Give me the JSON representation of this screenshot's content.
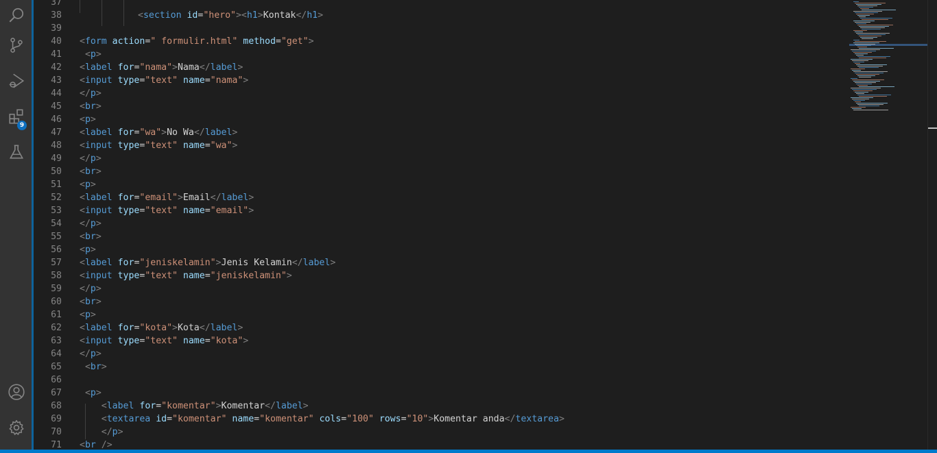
{
  "activity_bar": {
    "items": [
      {
        "name": "explorer-search",
        "icon": "search-icon"
      },
      {
        "name": "source-control",
        "icon": "source-control-icon"
      },
      {
        "name": "run-debug",
        "icon": "run-debug-icon"
      },
      {
        "name": "extensions",
        "icon": "extensions-icon",
        "badge": "9"
      },
      {
        "name": "testing",
        "icon": "flask-icon"
      }
    ],
    "bottom": [
      {
        "name": "accounts",
        "icon": "account-icon"
      },
      {
        "name": "manage",
        "icon": "gear-icon"
      }
    ],
    "accent": "#0e639c",
    "badge_color": "#0e70c0"
  },
  "editor": {
    "colors": {
      "background": "#1e1e1e",
      "tag": "#569cd6",
      "attribute": "#9cdcfe",
      "string": "#ce9178",
      "text": "#d4d4d4",
      "line_number": "#858585"
    },
    "lines": [
      {
        "n": "37",
        "tokens": []
      },
      {
        "n": "38",
        "tokens": [
          {
            "t": "<",
            "c": "punc"
          },
          {
            "t": "section",
            "c": "tag"
          },
          {
            "t": " ",
            "c": "txt"
          },
          {
            "t": "id",
            "c": "attr"
          },
          {
            "t": "=",
            "c": "txt"
          },
          {
            "t": "\"hero\"",
            "c": "str"
          },
          {
            "t": "><",
            "c": "punc"
          },
          {
            "t": "h1",
            "c": "tag"
          },
          {
            "t": ">",
            "c": "punc"
          },
          {
            "t": "Kontak",
            "c": "txt"
          },
          {
            "t": "</",
            "c": "punc"
          },
          {
            "t": "h1",
            "c": "tag"
          },
          {
            "t": ">",
            "c": "punc"
          }
        ]
      },
      {
        "n": "39",
        "tokens": []
      },
      {
        "n": "40",
        "tokens": [
          {
            "t": "<",
            "c": "punc"
          },
          {
            "t": "form",
            "c": "tag"
          },
          {
            "t": " ",
            "c": "txt"
          },
          {
            "t": "action",
            "c": "attr"
          },
          {
            "t": "=",
            "c": "txt"
          },
          {
            "t": "\" formulir.html\"",
            "c": "str"
          },
          {
            "t": " ",
            "c": "txt"
          },
          {
            "t": "method",
            "c": "attr"
          },
          {
            "t": "=",
            "c": "txt"
          },
          {
            "t": "\"get\"",
            "c": "str"
          },
          {
            "t": ">",
            "c": "punc"
          }
        ]
      },
      {
        "n": "41",
        "tokens": [
          {
            "t": " ",
            "c": "txt"
          },
          {
            "t": "<",
            "c": "punc"
          },
          {
            "t": "p",
            "c": "tag"
          },
          {
            "t": ">",
            "c": "punc"
          }
        ]
      },
      {
        "n": "42",
        "tokens": [
          {
            "t": "<",
            "c": "punc"
          },
          {
            "t": "label",
            "c": "tag"
          },
          {
            "t": " ",
            "c": "txt"
          },
          {
            "t": "for",
            "c": "attr"
          },
          {
            "t": "=",
            "c": "txt"
          },
          {
            "t": "\"nama\"",
            "c": "str"
          },
          {
            "t": ">",
            "c": "punc"
          },
          {
            "t": "Nama",
            "c": "txt"
          },
          {
            "t": "</",
            "c": "punc"
          },
          {
            "t": "label",
            "c": "tag"
          },
          {
            "t": ">",
            "c": "punc"
          }
        ]
      },
      {
        "n": "43",
        "tokens": [
          {
            "t": "<",
            "c": "punc"
          },
          {
            "t": "input",
            "c": "tag"
          },
          {
            "t": " ",
            "c": "txt"
          },
          {
            "t": "type",
            "c": "attr"
          },
          {
            "t": "=",
            "c": "txt"
          },
          {
            "t": "\"text\"",
            "c": "str"
          },
          {
            "t": " ",
            "c": "txt"
          },
          {
            "t": "name",
            "c": "attr"
          },
          {
            "t": "=",
            "c": "txt"
          },
          {
            "t": "\"nama\"",
            "c": "str"
          },
          {
            "t": ">",
            "c": "punc"
          }
        ]
      },
      {
        "n": "44",
        "tokens": [
          {
            "t": "</",
            "c": "punc"
          },
          {
            "t": "p",
            "c": "tag"
          },
          {
            "t": ">",
            "c": "punc"
          }
        ]
      },
      {
        "n": "45",
        "tokens": [
          {
            "t": "<",
            "c": "punc"
          },
          {
            "t": "br",
            "c": "tag"
          },
          {
            "t": ">",
            "c": "punc"
          }
        ]
      },
      {
        "n": "46",
        "tokens": [
          {
            "t": "<",
            "c": "punc"
          },
          {
            "t": "p",
            "c": "tag"
          },
          {
            "t": ">",
            "c": "punc"
          }
        ]
      },
      {
        "n": "47",
        "tokens": [
          {
            "t": "<",
            "c": "punc"
          },
          {
            "t": "label",
            "c": "tag"
          },
          {
            "t": " ",
            "c": "txt"
          },
          {
            "t": "for",
            "c": "attr"
          },
          {
            "t": "=",
            "c": "txt"
          },
          {
            "t": "\"wa\"",
            "c": "str"
          },
          {
            "t": ">",
            "c": "punc"
          },
          {
            "t": "No Wa",
            "c": "txt"
          },
          {
            "t": "</",
            "c": "punc"
          },
          {
            "t": "label",
            "c": "tag"
          },
          {
            "t": ">",
            "c": "punc"
          }
        ]
      },
      {
        "n": "48",
        "tokens": [
          {
            "t": "<",
            "c": "punc"
          },
          {
            "t": "input",
            "c": "tag"
          },
          {
            "t": " ",
            "c": "txt"
          },
          {
            "t": "type",
            "c": "attr"
          },
          {
            "t": "=",
            "c": "txt"
          },
          {
            "t": "\"text\"",
            "c": "str"
          },
          {
            "t": " ",
            "c": "txt"
          },
          {
            "t": "name",
            "c": "attr"
          },
          {
            "t": "=",
            "c": "txt"
          },
          {
            "t": "\"wa\"",
            "c": "str"
          },
          {
            "t": ">",
            "c": "punc"
          }
        ]
      },
      {
        "n": "49",
        "tokens": [
          {
            "t": "</",
            "c": "punc"
          },
          {
            "t": "p",
            "c": "tag"
          },
          {
            "t": ">",
            "c": "punc"
          }
        ]
      },
      {
        "n": "50",
        "tokens": [
          {
            "t": "<",
            "c": "punc"
          },
          {
            "t": "br",
            "c": "tag"
          },
          {
            "t": ">",
            "c": "punc"
          }
        ]
      },
      {
        "n": "51",
        "tokens": [
          {
            "t": "<",
            "c": "punc"
          },
          {
            "t": "p",
            "c": "tag"
          },
          {
            "t": ">",
            "c": "punc"
          }
        ]
      },
      {
        "n": "52",
        "tokens": [
          {
            "t": "<",
            "c": "punc"
          },
          {
            "t": "label",
            "c": "tag"
          },
          {
            "t": " ",
            "c": "txt"
          },
          {
            "t": "for",
            "c": "attr"
          },
          {
            "t": "=",
            "c": "txt"
          },
          {
            "t": "\"email\"",
            "c": "str"
          },
          {
            "t": ">",
            "c": "punc"
          },
          {
            "t": "Email",
            "c": "txt"
          },
          {
            "t": "</",
            "c": "punc"
          },
          {
            "t": "label",
            "c": "tag"
          },
          {
            "t": ">",
            "c": "punc"
          }
        ]
      },
      {
        "n": "53",
        "tokens": [
          {
            "t": "<",
            "c": "punc"
          },
          {
            "t": "input",
            "c": "tag"
          },
          {
            "t": " ",
            "c": "txt"
          },
          {
            "t": "type",
            "c": "attr"
          },
          {
            "t": "=",
            "c": "txt"
          },
          {
            "t": "\"text\"",
            "c": "str"
          },
          {
            "t": " ",
            "c": "txt"
          },
          {
            "t": "name",
            "c": "attr"
          },
          {
            "t": "=",
            "c": "txt"
          },
          {
            "t": "\"email\"",
            "c": "str"
          },
          {
            "t": ">",
            "c": "punc"
          }
        ]
      },
      {
        "n": "54",
        "tokens": [
          {
            "t": "</",
            "c": "punc"
          },
          {
            "t": "p",
            "c": "tag"
          },
          {
            "t": ">",
            "c": "punc"
          }
        ]
      },
      {
        "n": "55",
        "tokens": [
          {
            "t": "<",
            "c": "punc"
          },
          {
            "t": "br",
            "c": "tag"
          },
          {
            "t": ">",
            "c": "punc"
          }
        ]
      },
      {
        "n": "56",
        "tokens": [
          {
            "t": "<",
            "c": "punc"
          },
          {
            "t": "p",
            "c": "tag"
          },
          {
            "t": ">",
            "c": "punc"
          }
        ]
      },
      {
        "n": "57",
        "tokens": [
          {
            "t": "<",
            "c": "punc"
          },
          {
            "t": "label",
            "c": "tag"
          },
          {
            "t": " ",
            "c": "txt"
          },
          {
            "t": "for",
            "c": "attr"
          },
          {
            "t": "=",
            "c": "txt"
          },
          {
            "t": "\"jeniskelamin\"",
            "c": "str"
          },
          {
            "t": ">",
            "c": "punc"
          },
          {
            "t": "Jenis Kelamin",
            "c": "txt"
          },
          {
            "t": "</",
            "c": "punc"
          },
          {
            "t": "label",
            "c": "tag"
          },
          {
            "t": ">",
            "c": "punc"
          }
        ]
      },
      {
        "n": "58",
        "tokens": [
          {
            "t": "<",
            "c": "punc"
          },
          {
            "t": "input",
            "c": "tag"
          },
          {
            "t": " ",
            "c": "txt"
          },
          {
            "t": "type",
            "c": "attr"
          },
          {
            "t": "=",
            "c": "txt"
          },
          {
            "t": "\"text\"",
            "c": "str"
          },
          {
            "t": " ",
            "c": "txt"
          },
          {
            "t": "name",
            "c": "attr"
          },
          {
            "t": "=",
            "c": "txt"
          },
          {
            "t": "\"jeniskelamin\"",
            "c": "str"
          },
          {
            "t": ">",
            "c": "punc"
          }
        ]
      },
      {
        "n": "59",
        "tokens": [
          {
            "t": "</",
            "c": "punc"
          },
          {
            "t": "p",
            "c": "tag"
          },
          {
            "t": ">",
            "c": "punc"
          }
        ]
      },
      {
        "n": "60",
        "tokens": [
          {
            "t": "<",
            "c": "punc"
          },
          {
            "t": "br",
            "c": "tag"
          },
          {
            "t": ">",
            "c": "punc"
          }
        ]
      },
      {
        "n": "61",
        "tokens": [
          {
            "t": "<",
            "c": "punc"
          },
          {
            "t": "p",
            "c": "tag"
          },
          {
            "t": ">",
            "c": "punc"
          }
        ]
      },
      {
        "n": "62",
        "tokens": [
          {
            "t": "<",
            "c": "punc"
          },
          {
            "t": "label",
            "c": "tag"
          },
          {
            "t": " ",
            "c": "txt"
          },
          {
            "t": "for",
            "c": "attr"
          },
          {
            "t": "=",
            "c": "txt"
          },
          {
            "t": "\"kota\"",
            "c": "str"
          },
          {
            "t": ">",
            "c": "punc"
          },
          {
            "t": "Kota",
            "c": "txt"
          },
          {
            "t": "</",
            "c": "punc"
          },
          {
            "t": "label",
            "c": "tag"
          },
          {
            "t": ">",
            "c": "punc"
          }
        ]
      },
      {
        "n": "63",
        "tokens": [
          {
            "t": "<",
            "c": "punc"
          },
          {
            "t": "input",
            "c": "tag"
          },
          {
            "t": " ",
            "c": "txt"
          },
          {
            "t": "type",
            "c": "attr"
          },
          {
            "t": "=",
            "c": "txt"
          },
          {
            "t": "\"text\"",
            "c": "str"
          },
          {
            "t": " ",
            "c": "txt"
          },
          {
            "t": "name",
            "c": "attr"
          },
          {
            "t": "=",
            "c": "txt"
          },
          {
            "t": "\"kota\"",
            "c": "str"
          },
          {
            "t": ">",
            "c": "punc"
          }
        ]
      },
      {
        "n": "64",
        "tokens": [
          {
            "t": "</",
            "c": "punc"
          },
          {
            "t": "p",
            "c": "tag"
          },
          {
            "t": ">",
            "c": "punc"
          }
        ]
      },
      {
        "n": "65",
        "tokens": [
          {
            "t": " ",
            "c": "txt"
          },
          {
            "t": "<",
            "c": "punc"
          },
          {
            "t": "br",
            "c": "tag"
          },
          {
            "t": ">",
            "c": "punc"
          }
        ]
      },
      {
        "n": "66",
        "tokens": []
      },
      {
        "n": "67",
        "tokens": [
          {
            "t": " ",
            "c": "txt"
          },
          {
            "t": "<",
            "c": "punc"
          },
          {
            "t": "p",
            "c": "tag"
          },
          {
            "t": ">",
            "c": "punc"
          }
        ]
      },
      {
        "n": "68",
        "tokens": [
          {
            "t": "    ",
            "c": "txt"
          },
          {
            "t": "<",
            "c": "punc"
          },
          {
            "t": "label",
            "c": "tag"
          },
          {
            "t": " ",
            "c": "txt"
          },
          {
            "t": "for",
            "c": "attr"
          },
          {
            "t": "=",
            "c": "txt"
          },
          {
            "t": "\"komentar\"",
            "c": "str"
          },
          {
            "t": ">",
            "c": "punc"
          },
          {
            "t": "Komentar",
            "c": "txt"
          },
          {
            "t": "</",
            "c": "punc"
          },
          {
            "t": "label",
            "c": "tag"
          },
          {
            "t": ">",
            "c": "punc"
          }
        ]
      },
      {
        "n": "69",
        "tokens": [
          {
            "t": "    ",
            "c": "txt"
          },
          {
            "t": "<",
            "c": "punc"
          },
          {
            "t": "textarea",
            "c": "tag"
          },
          {
            "t": " ",
            "c": "txt"
          },
          {
            "t": "id",
            "c": "attr"
          },
          {
            "t": "=",
            "c": "txt"
          },
          {
            "t": "\"komentar\"",
            "c": "str"
          },
          {
            "t": " ",
            "c": "txt"
          },
          {
            "t": "name",
            "c": "attr"
          },
          {
            "t": "=",
            "c": "txt"
          },
          {
            "t": "\"komentar\"",
            "c": "str"
          },
          {
            "t": " ",
            "c": "txt"
          },
          {
            "t": "cols",
            "c": "attr"
          },
          {
            "t": "=",
            "c": "txt"
          },
          {
            "t": "\"100\"",
            "c": "str"
          },
          {
            "t": " ",
            "c": "txt"
          },
          {
            "t": "rows",
            "c": "attr"
          },
          {
            "t": "=",
            "c": "txt"
          },
          {
            "t": "\"10\"",
            "c": "str"
          },
          {
            "t": ">",
            "c": "punc"
          },
          {
            "t": "Komentar anda",
            "c": "txt"
          },
          {
            "t": "</",
            "c": "punc"
          },
          {
            "t": "textarea",
            "c": "tag"
          },
          {
            "t": ">",
            "c": "punc"
          }
        ]
      },
      {
        "n": "70",
        "tokens": [
          {
            "t": "    ",
            "c": "txt"
          },
          {
            "t": "</",
            "c": "punc"
          },
          {
            "t": "p",
            "c": "tag"
          },
          {
            "t": ">",
            "c": "punc"
          }
        ]
      },
      {
        "n": "71",
        "tokens": [
          {
            "t": "<",
            "c": "punc"
          },
          {
            "t": "br",
            "c": "tag"
          },
          {
            "t": " />",
            "c": "punc"
          }
        ]
      }
    ]
  },
  "statusbar": {
    "color": "#007acc"
  }
}
